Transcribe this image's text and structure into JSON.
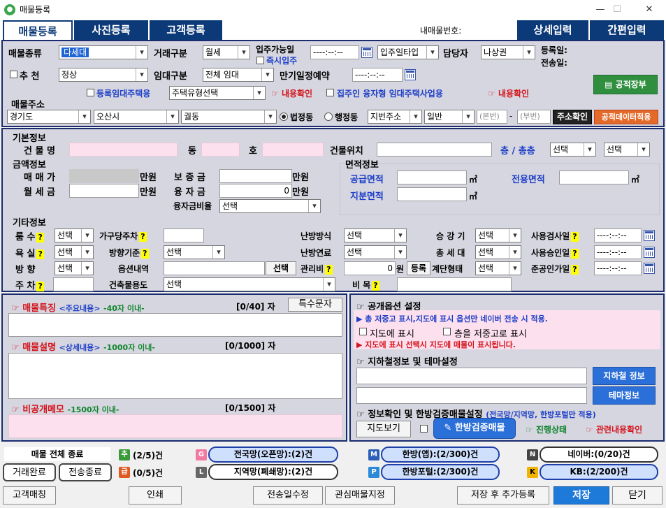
{
  "window": {
    "title": "매물등록",
    "min": "—",
    "max": "☐",
    "close": "✕"
  },
  "tabs": {
    "t1": "매물등록",
    "t2": "사진등록",
    "t3": "고객등록",
    "my_no": "내매물번호:",
    "detail": "상세입력",
    "simple": "간편입력"
  },
  "top": {
    "type_lbl": "매물종류",
    "type_val": "다세대",
    "deal_lbl": "거래구분",
    "deal_val": "월세",
    "movein_lbl": "입주가능일",
    "movein_val": "----:--:--",
    "movein_type": "입주일타입",
    "movein_now": "즉시입주",
    "agent_lbl": "담당자",
    "agent_val": "나상권",
    "regdate": "등록일:",
    "senddate": "전송일:",
    "rec_lbl": "추 천",
    "rec_val": "정상",
    "lease_lbl": "임대구분",
    "lease_val": "전체 임대",
    "expire_lbl": "만기일정예약",
    "expire_val": "----:--:--",
    "reg_lease": "등록임대주택용",
    "house_type": "주택유형선택",
    "confirm1": "내용확인",
    "landlord": "집주인 융자형 임대주택사업용",
    "confirm2": "내용확인",
    "ledger_btn": "공적장부",
    "addr_lbl": "매물주소",
    "sido": "경기도",
    "sigungu": "오산시",
    "dong": "궐동",
    "r_legal": "법정동",
    "r_admin": "행정동",
    "addr_kind": "지번주소",
    "addr_gen": "일반",
    "main_no": "(본번)",
    "dash": "-",
    "sub_no": "(부번)",
    "addr_check": "주소확인",
    "public_data": "공적데이터적용"
  },
  "basic": {
    "hdr": "기본정보",
    "bldg": "건 물 명",
    "dong": "동",
    "ho": "호",
    "loc": "건물위치",
    "floor": "층 / 총층",
    "floor_val": "선택",
    "total_val": "선택"
  },
  "money": {
    "hdr": "금액정보",
    "sale": "매 매 가",
    "unit": "만원",
    "deposit": "보 증 금",
    "monthly": "월 세 금",
    "loan": "융 자 금",
    "loan_val": "0",
    "loan_ratio": "융자금비율",
    "ratio_val": "선택"
  },
  "area": {
    "hdr": "면적정보",
    "supply": "공급면적",
    "exclusive": "전용면적",
    "land": "지분면적",
    "m2": "㎡"
  },
  "etc": {
    "hdr": "기타정보",
    "rooms": "룸 수",
    "rooms_val": "선택",
    "parking_per": "가구당주차",
    "heat": "난방방식",
    "heat_val": "선택",
    "elev": "승 강 기",
    "elev_val": "선택",
    "usage_date": "사용검사일",
    "usage_val": "----:--:--",
    "bath": "욕 실",
    "bath_val": "선택",
    "dir_base": "방향기준",
    "dir_base_val": "선택",
    "fuel": "난방연료",
    "fuel_val": "선택",
    "households": "총 세 대",
    "hh_val": "선택",
    "approve": "사용승인일",
    "approve_val": "----:--:--",
    "dir": "방 향",
    "dir_val": "선택",
    "options": "옵션내역",
    "opt_btn": "선택",
    "mgmt": "관리비",
    "mgmt_val": "0",
    "won": "원",
    "reg_btn": "등록",
    "stair": "계단형태",
    "stair_val": "선택",
    "complete": "준공인가일",
    "complete_val": "----:--:--",
    "park": "주 차",
    "use": "건축물용도",
    "use_val": "선택",
    "remark": "비 목"
  },
  "feat": {
    "t1": "매물특징",
    "s1": "<주요내용>",
    "l1": "-40자 이내-",
    "c1": "[0/40] 자",
    "special": "특수문자",
    "t2": "매물설명",
    "s2": "<상세내용>",
    "l2": "-1000자 이내-",
    "c2": "[0/1000] 자",
    "t3": "비공개메모",
    "l3": "-1500자 이내-",
    "c3": "[0/1500] 자"
  },
  "pub": {
    "hdr": "공개옵션 설정",
    "note": "▶ 총 저중고 표시,지도에 표시 옵션만 네이버 전송 시 적용.",
    "map": "지도에 표시",
    "low": "층을 저중고로 표시",
    "warn": "▶ 지도에 표시 선택시 지도에 매물이 표시됩니다.",
    "sub_hdr": "지하철정보 및 테마설정",
    "subway_btn": "지하철 정보",
    "theme_btn": "테마정보",
    "verify_hdr": "정보확인 및 한방검증매물설정",
    "verify_sub": "(전국망/지역망, 한방포털만 적용)",
    "map_btn": "지도보기",
    "verify_btn": "한방검증매물",
    "progress": "진행상태",
    "related": "관련내용확인"
  },
  "bottom": {
    "all_end": "매물 전체 종료",
    "deal_done": "거래완료",
    "send_end": "전송종료",
    "cnt1": "(2/5)건",
    "cnt2": "(0/5)건",
    "national": "전국망(오픈망):(2)건",
    "regional": "지역망(폐쇄망):(2)건",
    "hb_app": "한방(앱):(2/300)건",
    "hb_portal": "한방포털:(2/300)건",
    "naver": "네이버:(0/20)건",
    "kb": "KB:(2/200)건",
    "b_cust": "고객매칭",
    "b_print": "인쇄",
    "b_send": "전송일수정",
    "b_fav": "관심매물지정",
    "b_saveadd": "저장 후 추가등록",
    "b_save": "저장",
    "b_close": "닫기",
    "badge_chu": "추",
    "badge_gyeo": "급",
    "badge_g": "G",
    "badge_l": "L",
    "badge_m": "M",
    "badge_p": "P",
    "badge_n": "N",
    "badge_k": "K"
  }
}
